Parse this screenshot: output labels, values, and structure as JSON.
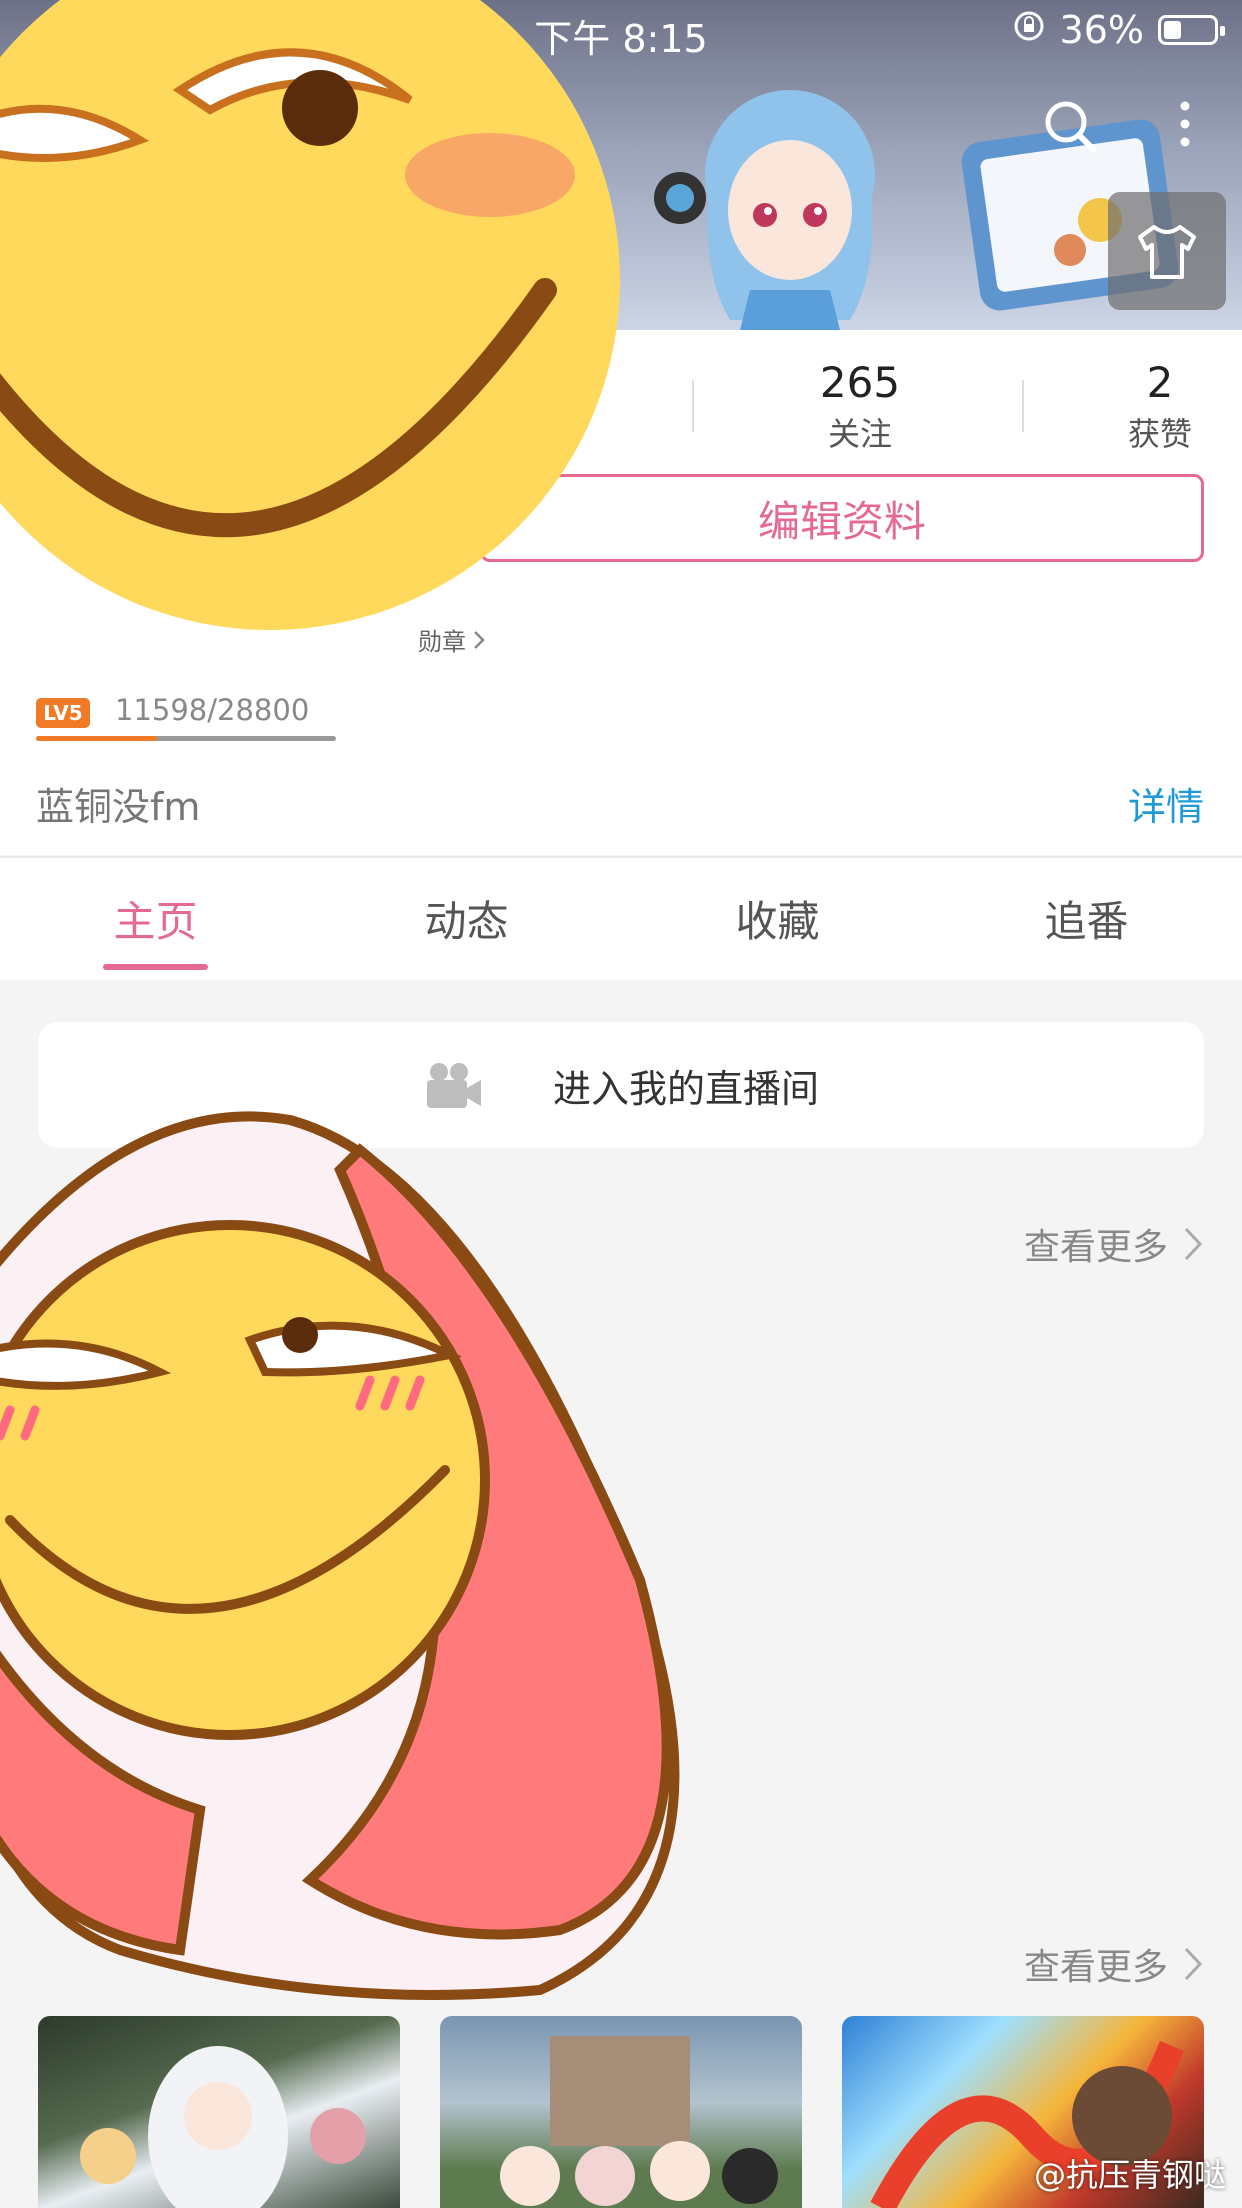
{
  "status_bar": {
    "time": "下午 8:15",
    "battery": "36%",
    "battery_level": 0.36
  },
  "stats": [
    {
      "value": "265",
      "label": "关注"
    },
    {
      "value": "2",
      "label": "获赞"
    }
  ],
  "profile": {
    "edit_button": "编辑资料",
    "medal_link": "勋章",
    "level_badge": "LV5",
    "exp": "11598/28800",
    "exp_progress": 0.4027,
    "bio": "蓝铜没fm",
    "detail_link": "详情"
  },
  "tabs": [
    {
      "label": "主页",
      "active": true
    },
    {
      "label": "动态",
      "active": false
    },
    {
      "label": "收藏",
      "active": false
    },
    {
      "label": "追番",
      "active": false
    }
  ],
  "live": {
    "label": "进入我的直播间"
  },
  "sections": [
    {
      "more_label": "查看更多"
    },
    {
      "more_label": "查看更多"
    }
  ],
  "watermark": "@抗压青钢哒",
  "colors": {
    "accent_pink": "#e46a92",
    "link_blue": "#1e9bd7",
    "level_orange": "#f07a25"
  }
}
